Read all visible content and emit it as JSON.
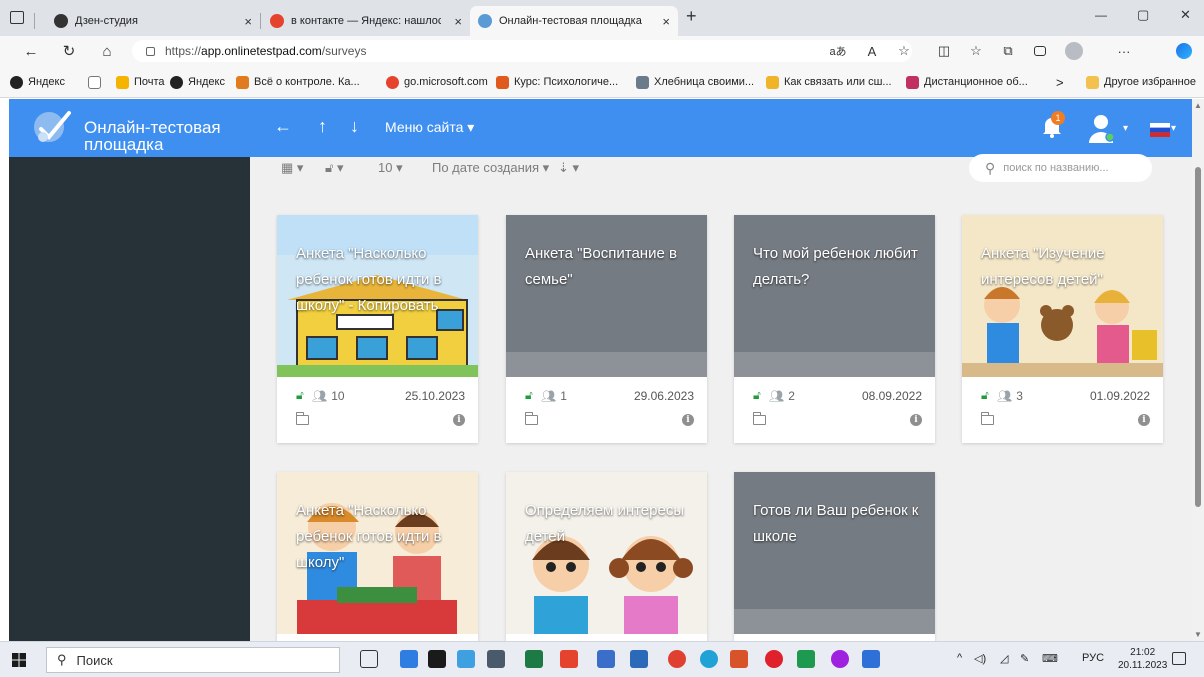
{
  "browser": {
    "tabs": [
      {
        "title": "Дзен-студия",
        "close": "×",
        "favicon_color": "#333333"
      },
      {
        "title": "в контакте — Яндекс: нашлось",
        "close": "×",
        "favicon_color": "#e6432f"
      },
      {
        "title": "Онлайн-тестовая площадка",
        "close": "×",
        "favicon_color": "#5b9bd5",
        "active": true
      }
    ],
    "new_tab": "+",
    "window_controls": {
      "minimize": "—",
      "restore": "▢",
      "close": "✕"
    },
    "url": "https://app.onlinetestpad.com/surveys",
    "url_prefix": "https://",
    "url_host": "app.onlinetestpad.com",
    "url_path": "/surveys",
    "nav": {
      "back": "←",
      "reload": "↻",
      "home": "⌂"
    },
    "address_icons": {
      "translate": "aあ",
      "read_aloud": "A",
      "favorite": "☆"
    },
    "toolbar_icons": {
      "split": "◫",
      "favorites": "☆",
      "collections": "⧉",
      "more": "···"
    },
    "favorites": [
      {
        "label": "Яндекс",
        "color": "#222222"
      },
      {
        "label": "",
        "color": "#777777"
      },
      {
        "label": "Почта",
        "color": "#f5b400"
      },
      {
        "label": "Яндекс",
        "color": "#222222"
      },
      {
        "label": "Всё о контроле. Ка...",
        "color": "#e07b1e"
      },
      {
        "label": "go.microsoft.com",
        "color": "#e6432f"
      },
      {
        "label": "Курс: Психологиче...",
        "color": "#e05a1e"
      },
      {
        "label": "Хлебница своими...",
        "color": "#6b7b8c"
      },
      {
        "label": "Как связать или сш...",
        "color": "#f0b429"
      },
      {
        "label": "Дистанционное об...",
        "color": "#c03060"
      }
    ],
    "favorites_overflow": ">",
    "other_favorites": "Другое избранное"
  },
  "app": {
    "brand": "Онлайн-тестовая площадка",
    "nav": {
      "back": "←",
      "up": "↑",
      "down": "↓"
    },
    "site_menu": "Меню сайта ▾",
    "notifications_count": "1",
    "user_caret": "▾",
    "flag_caret": "▾",
    "colors": {
      "appbar": "#3f8ff0",
      "sidebar": "#263238",
      "content": "#f0f0f0",
      "lock": "#1f9d3b"
    }
  },
  "toolbar": {
    "view_icon": "▦ ▾",
    "access_icon": "🔓︎ ▾",
    "page_size": "10 ▾",
    "sort": "По дате создания ▾",
    "sort_dir": "⇣ ▾",
    "search_placeholder": "поиск по названию..."
  },
  "cards": [
    {
      "title": "Анкета \"Насколько ребенок готов идти в школу\" - Копировать",
      "users": "10",
      "date": "25.10.2023",
      "image": "school-building"
    },
    {
      "title": "Анкета \"Воспитание в семье\"",
      "users": "1",
      "date": "29.06.2023",
      "image": "none"
    },
    {
      "title": "Что мой ребенок любит делать?",
      "users": "2",
      "date": "08.09.2022",
      "image": "none"
    },
    {
      "title": "Анкета \"Изучение интересов детей\"",
      "users": "3",
      "date": "01.09.2022",
      "image": "kids-with-toys"
    },
    {
      "title": "Анкета \"Насколько ребенок готов идти в школу\"",
      "users": "",
      "date": "",
      "image": "kids-with-books"
    },
    {
      "title": "Определяем интересы детей",
      "users": "",
      "date": "",
      "image": "cartoon-kids"
    },
    {
      "title": "Готов ли Ваш ребенок к школе",
      "users": "",
      "date": "",
      "image": "none"
    }
  ],
  "card_icons": {
    "lock": "🔓︎",
    "users": "👥︎",
    "info": "i"
  },
  "taskbar": {
    "search": "Поиск",
    "tray": {
      "arrow": "^",
      "lang": "РУС"
    },
    "time": "21:02",
    "date": "20.11.2023"
  }
}
